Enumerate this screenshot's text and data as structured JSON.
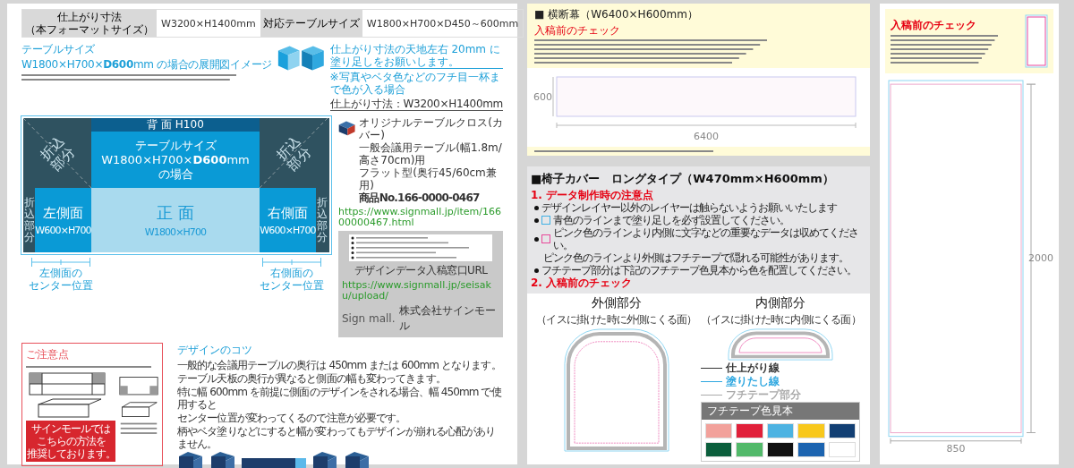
{
  "page1": {
    "spec_table": [
      {
        "label": [
          "仕上がり寸法",
          "（本フォーマットサイズ）"
        ],
        "value": "W3200×H1400mm"
      },
      {
        "label": [
          "対応テーブルサイズ"
        ],
        "value": "W1800×H700×D450～600mm"
      }
    ],
    "heading": {
      "line1": "テーブルサイズ",
      "line2": "W1800×H700×**D600**mm の場合の展開図イメージ"
    },
    "bleed_note": {
      "title": "仕上がり寸法の天地左右 20mm に塗り足しをお願いします。",
      "sub": "※写真やベタ色などのフチ目一杯まで色が入る場合",
      "size": "仕上がり寸法：W3200×H1400mm"
    },
    "layout": {
      "back": "背 面 H100",
      "center": [
        "テーブルサイズ",
        "W1800×H700×**D600**mm",
        "の場合"
      ],
      "folds": [
        "折込部分",
        "折込部分",
        "折込部分",
        "折込部分"
      ],
      "faces": [
        {
          "kind": "side",
          "name": "左側面",
          "size": "W600×H700"
        },
        {
          "kind": "front",
          "name": "正 面",
          "size": "W1800×H700"
        },
        {
          "kind": "side",
          "name": "右側面",
          "size": "W600×H700"
        }
      ]
    },
    "center_marks": [
      [
        "左側面の",
        "センター位置"
      ],
      [
        "右側面の",
        "センター位置"
      ]
    ],
    "product": {
      "name": "オリジナルテーブルクロス(カバー)",
      "lines": [
        "一般会議用テーブル(幅1.8m/高さ70cm)用",
        "フラット型(奥行45/60cm兼用)"
      ],
      "number": "商品No.166-0000-0467",
      "url": "https://www.signmall.jp/item/16600000467.html",
      "upload_label": "デザインデータ入稿窓口URL",
      "upload_url": "https://www.signmall.jp/seisaku/upload/",
      "logo": "Sign mall.",
      "company": "株式会社サインモール"
    },
    "notice": {
      "title": "ご注意点",
      "recommend": [
        "サインモールでは",
        "こちらの方法を",
        "推奨しております。"
      ]
    },
    "tips": {
      "title": "デザインのコツ",
      "lines": [
        "一般的な会議用テーブルの奥行は 450mm または 600mm となります。",
        "テーブル天板の奥行が異なると側面の幅も変わってきます。",
        "特に幅 600mm を前提に側面のデザインをされる場合、幅 450mm で使用すると",
        "センター位置が変わってくるので注意が必要です。",
        "柄やベタ塗りなどにすると幅が変わってもデザインが崩れる心配がありません。"
      ]
    }
  },
  "page2a": {
    "title": "■ 横断幕（W6400×H600mm）",
    "check_title": "入稿前のチェック",
    "width_label": "6400",
    "height_label": "600"
  },
  "page2b": {
    "title": "■椅子カバー　ロングタイプ（W470mm×H600mm）",
    "section1": "1. データ制作時の注意点",
    "notes": [
      {
        "kind": "plain",
        "text": "デザインレイヤー以外のレイヤーは触らないようお願いいたします"
      },
      {
        "kind": "blue",
        "text": "青色のラインまで塗り足しを必ず設置してください。"
      },
      {
        "kind": "pink",
        "text": "ピンク色のラインより内側に文字などの重要なデータは収めてください。"
      },
      {
        "kind": "cont",
        "text": "ピンク色のラインより外側はフチテープで隠れる可能性があります。"
      },
      {
        "kind": "plain",
        "text": "フチテープ部分は下記のフチテープ色見本から色を配置してください。"
      }
    ],
    "section2": "2. 入稿前のチェック",
    "outer": {
      "title": "外側部分",
      "sub": "（イスに掛けた時に外側にくる面）"
    },
    "inner": {
      "title": "内側部分",
      "sub": "（イスに掛けた時に内側にくる面）"
    },
    "legend": [
      {
        "kind": "trim",
        "label": "仕上がり線"
      },
      {
        "kind": "bleed",
        "label": "塗りたし線"
      },
      {
        "kind": "tape",
        "label": "フチテープ部分"
      }
    ],
    "swatch_title": "フチテープ色見本",
    "swatches": [
      {
        "color": "#f2a19b"
      },
      {
        "color": "#e1203a"
      },
      {
        "color": "#4db3e2"
      },
      {
        "color": "#f8c81c"
      },
      {
        "color": "#123f73"
      },
      {
        "color": "#0b5e3c"
      },
      {
        "color": "#52b96a"
      },
      {
        "color": "#111111"
      },
      {
        "color": "#1c64b0"
      },
      {
        "color": "#ffffff"
      }
    ]
  },
  "page3": {
    "check_title": "入稿前のチェック",
    "width_label": "850",
    "height_label": "2000"
  }
}
